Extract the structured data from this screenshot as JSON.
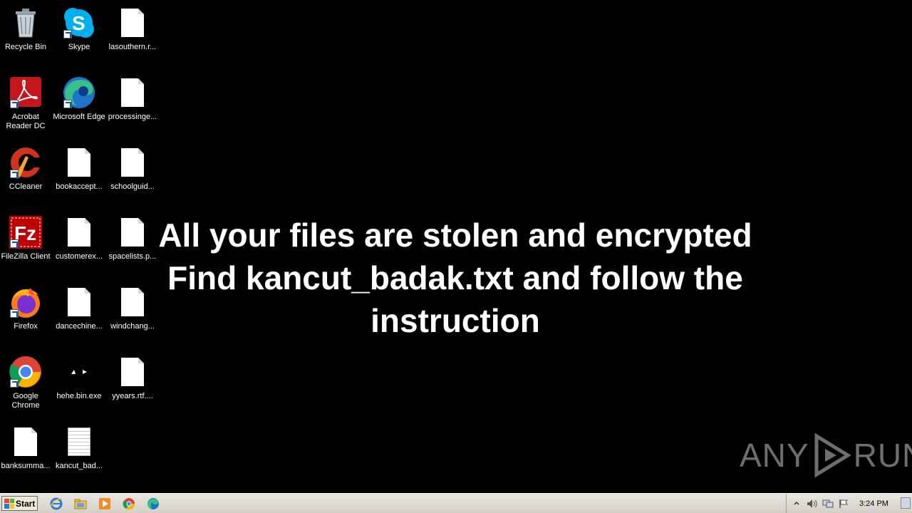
{
  "desktop": {
    "icons": [
      {
        "label": "Recycle Bin"
      },
      {
        "label": "Skype"
      },
      {
        "label": "lasouthern.r..."
      },
      {
        "label": "Acrobat Reader DC"
      },
      {
        "label": "Microsoft Edge"
      },
      {
        "label": "processinge..."
      },
      {
        "label": "CCleaner"
      },
      {
        "label": "bookaccept..."
      },
      {
        "label": "schoolguid..."
      },
      {
        "label": "FileZilla Client"
      },
      {
        "label": "customerex..."
      },
      {
        "label": "spacelists.p..."
      },
      {
        "label": "Firefox"
      },
      {
        "label": "dancechine..."
      },
      {
        "label": "windchang..."
      },
      {
        "label": "Google Chrome"
      },
      {
        "label": "hehe.bin.exe"
      },
      {
        "label": "yyears.rtf...."
      },
      {
        "label": "banksumma..."
      },
      {
        "label": "kancut_bad..."
      }
    ]
  },
  "ransom_note": {
    "line1": "All your files are stolen and encrypted",
    "line2": "Find kancut_badak.txt and follow the",
    "line3": "instruction"
  },
  "watermark": {
    "left": "ANY",
    "right": "RUN"
  },
  "taskbar": {
    "start_label": "Start",
    "clock": "3:24 PM"
  },
  "colors": {
    "desktop_bg": "#000000",
    "taskbar_bg": "#d4d0c8",
    "text": "#ffffff"
  }
}
